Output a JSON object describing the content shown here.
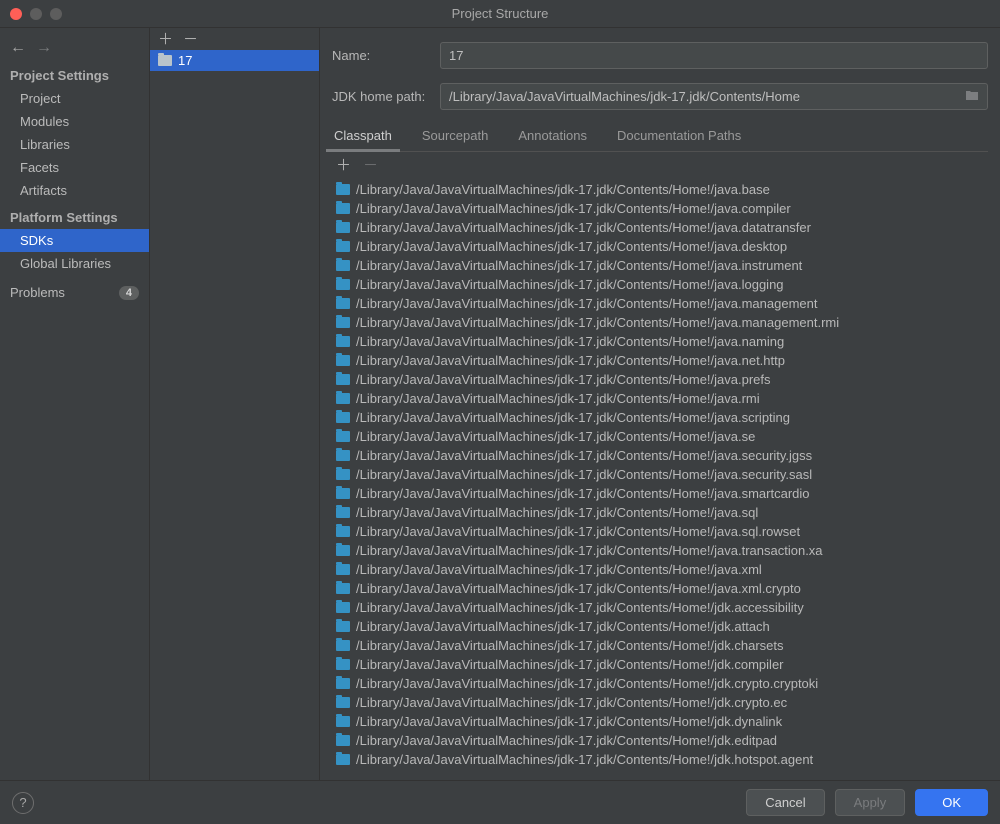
{
  "window": {
    "title": "Project Structure"
  },
  "nav": {
    "sections": {
      "project_settings": {
        "title": "Project Settings",
        "items": [
          "Project",
          "Modules",
          "Libraries",
          "Facets",
          "Artifacts"
        ]
      },
      "platform_settings": {
        "title": "Platform Settings",
        "items": [
          "SDKs",
          "Global Libraries"
        ]
      }
    },
    "problems": {
      "label": "Problems",
      "count": "4"
    }
  },
  "sdk_list": {
    "items": [
      "17"
    ],
    "selected": "17"
  },
  "form": {
    "name_label": "Name:",
    "name_value": "17",
    "path_label": "JDK home path:",
    "path_value": "/Library/Java/JavaVirtualMachines/jdk-17.jdk/Contents/Home"
  },
  "tabs": {
    "items": [
      "Classpath",
      "Sourcepath",
      "Annotations",
      "Documentation Paths"
    ],
    "active": "Classpath"
  },
  "classpath": [
    "/Library/Java/JavaVirtualMachines/jdk-17.jdk/Contents/Home!/java.base",
    "/Library/Java/JavaVirtualMachines/jdk-17.jdk/Contents/Home!/java.compiler",
    "/Library/Java/JavaVirtualMachines/jdk-17.jdk/Contents/Home!/java.datatransfer",
    "/Library/Java/JavaVirtualMachines/jdk-17.jdk/Contents/Home!/java.desktop",
    "/Library/Java/JavaVirtualMachines/jdk-17.jdk/Contents/Home!/java.instrument",
    "/Library/Java/JavaVirtualMachines/jdk-17.jdk/Contents/Home!/java.logging",
    "/Library/Java/JavaVirtualMachines/jdk-17.jdk/Contents/Home!/java.management",
    "/Library/Java/JavaVirtualMachines/jdk-17.jdk/Contents/Home!/java.management.rmi",
    "/Library/Java/JavaVirtualMachines/jdk-17.jdk/Contents/Home!/java.naming",
    "/Library/Java/JavaVirtualMachines/jdk-17.jdk/Contents/Home!/java.net.http",
    "/Library/Java/JavaVirtualMachines/jdk-17.jdk/Contents/Home!/java.prefs",
    "/Library/Java/JavaVirtualMachines/jdk-17.jdk/Contents/Home!/java.rmi",
    "/Library/Java/JavaVirtualMachines/jdk-17.jdk/Contents/Home!/java.scripting",
    "/Library/Java/JavaVirtualMachines/jdk-17.jdk/Contents/Home!/java.se",
    "/Library/Java/JavaVirtualMachines/jdk-17.jdk/Contents/Home!/java.security.jgss",
    "/Library/Java/JavaVirtualMachines/jdk-17.jdk/Contents/Home!/java.security.sasl",
    "/Library/Java/JavaVirtualMachines/jdk-17.jdk/Contents/Home!/java.smartcardio",
    "/Library/Java/JavaVirtualMachines/jdk-17.jdk/Contents/Home!/java.sql",
    "/Library/Java/JavaVirtualMachines/jdk-17.jdk/Contents/Home!/java.sql.rowset",
    "/Library/Java/JavaVirtualMachines/jdk-17.jdk/Contents/Home!/java.transaction.xa",
    "/Library/Java/JavaVirtualMachines/jdk-17.jdk/Contents/Home!/java.xml",
    "/Library/Java/JavaVirtualMachines/jdk-17.jdk/Contents/Home!/java.xml.crypto",
    "/Library/Java/JavaVirtualMachines/jdk-17.jdk/Contents/Home!/jdk.accessibility",
    "/Library/Java/JavaVirtualMachines/jdk-17.jdk/Contents/Home!/jdk.attach",
    "/Library/Java/JavaVirtualMachines/jdk-17.jdk/Contents/Home!/jdk.charsets",
    "/Library/Java/JavaVirtualMachines/jdk-17.jdk/Contents/Home!/jdk.compiler",
    "/Library/Java/JavaVirtualMachines/jdk-17.jdk/Contents/Home!/jdk.crypto.cryptoki",
    "/Library/Java/JavaVirtualMachines/jdk-17.jdk/Contents/Home!/jdk.crypto.ec",
    "/Library/Java/JavaVirtualMachines/jdk-17.jdk/Contents/Home!/jdk.dynalink",
    "/Library/Java/JavaVirtualMachines/jdk-17.jdk/Contents/Home!/jdk.editpad",
    "/Library/Java/JavaVirtualMachines/jdk-17.jdk/Contents/Home!/jdk.hotspot.agent"
  ],
  "footer": {
    "cancel": "Cancel",
    "apply": "Apply",
    "ok": "OK"
  }
}
